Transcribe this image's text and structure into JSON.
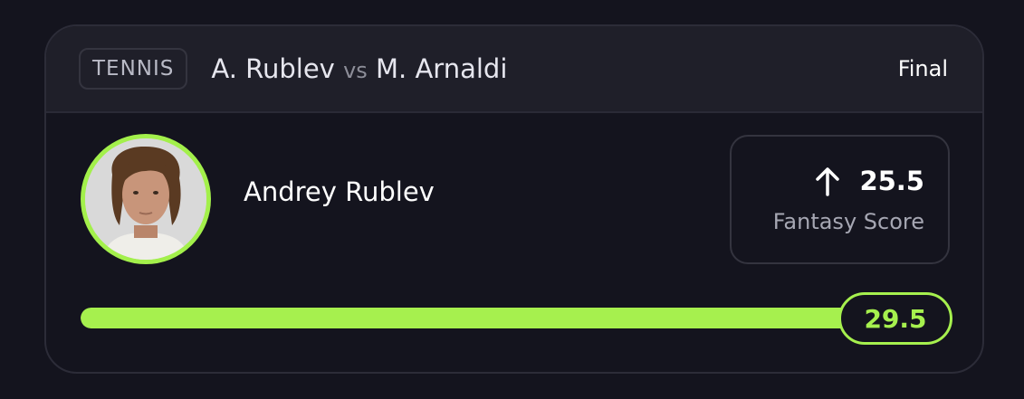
{
  "header": {
    "sport": "TENNIS",
    "player_a": "A. Rublev",
    "vs": "vs",
    "player_b": "M. Arnaldi",
    "status": "Final"
  },
  "player": {
    "name": "Andrey Rublev",
    "avatar_ring_color": "#a3f04b"
  },
  "score": {
    "direction_icon": "arrow-up-icon",
    "value": "25.5",
    "label": "Fantasy Score"
  },
  "progress": {
    "line": "29.5",
    "fill_fraction": 1.0,
    "accent_color": "#a6f04e"
  }
}
